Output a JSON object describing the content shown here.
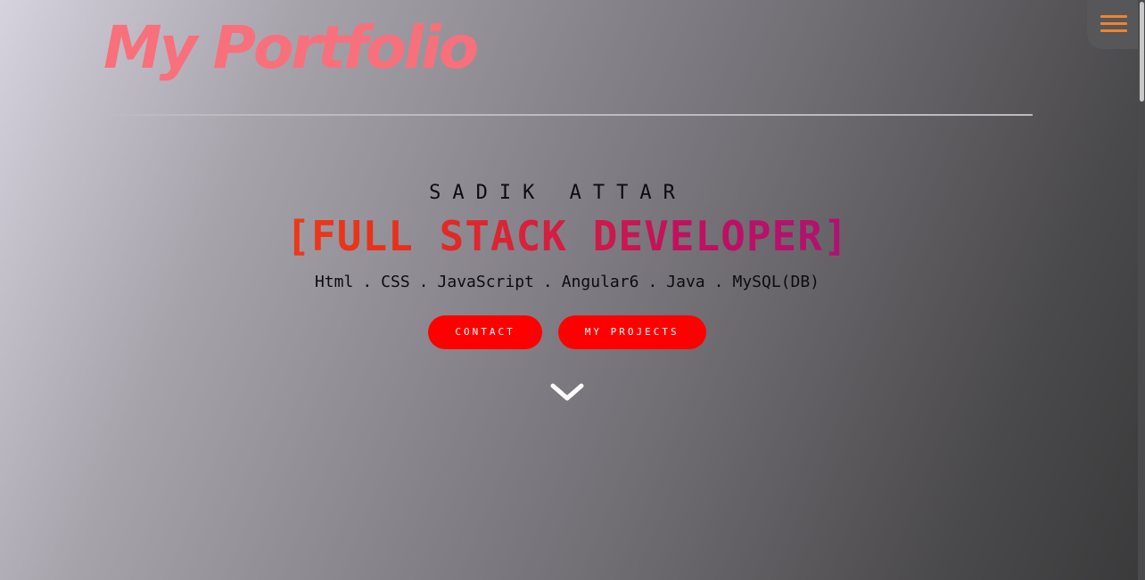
{
  "header": {
    "logo_text": "My Portfolio"
  },
  "nav": {
    "menu_icon": "hamburger-menu-icon"
  },
  "hero": {
    "name": "SADIK ATTAR",
    "title": "[FULL STACK DEVELOPER]",
    "skills": [
      "Html",
      "CSS",
      "JavaScript",
      "Angular6",
      "Java",
      "MySQL(DB)"
    ],
    "skills_separator": "."
  },
  "buttons": {
    "contact_label": "CONTACT",
    "projects_label": "MY PROJECTS"
  },
  "scroll": {
    "icon": "chevron-down-icon"
  },
  "colors": {
    "logo": "#f8707b",
    "button": "#ff0000",
    "menu_bars": "#f0842f",
    "title_gradient_start": "#f5521e",
    "title_gradient_end": "#8e1493"
  }
}
